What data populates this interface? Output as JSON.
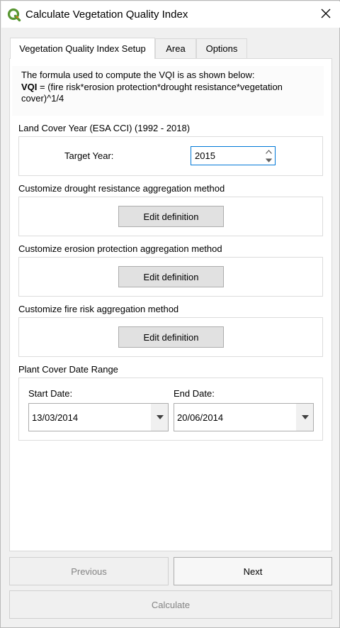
{
  "window": {
    "title": "Calculate Vegetation Quality Index",
    "logo_icon": "qgis-logo-icon",
    "close_icon": "close-icon"
  },
  "tabs": [
    {
      "label": "Vegetation Quality Index Setup",
      "active": true
    },
    {
      "label": "Area",
      "active": false
    },
    {
      "label": "Options",
      "active": false
    }
  ],
  "formula": {
    "intro": "The formula used to compute the VQI is as shown below:",
    "symbol": "VQI",
    "expression": " = (fire risk*erosion protection*drought resistance*vegetation cover)^1/4"
  },
  "land_cover": {
    "section_label": "Land Cover Year (ESA CCI) (1992 - 2018)",
    "target_year_label": "Target Year:",
    "target_year_value": "2015"
  },
  "drought": {
    "section_label": "Customize drought resistance aggregation method",
    "button_label": "Edit definition"
  },
  "erosion": {
    "section_label": "Customize erosion protection aggregation method",
    "button_label": "Edit definition"
  },
  "fire": {
    "section_label": "Customize fire risk aggregation method",
    "button_label": "Edit definition"
  },
  "plant_cover": {
    "section_label": "Plant Cover Date Range",
    "start_label": "Start Date:",
    "start_value": "13/03/2014",
    "end_label": "End Date:",
    "end_value": "20/06/2014"
  },
  "footer": {
    "previous_label": "Previous",
    "next_label": "Next",
    "calculate_label": "Calculate"
  },
  "colors": {
    "accent": "#0078d7",
    "qgis_green": "#589632",
    "qgis_yellow": "#ee7913"
  }
}
